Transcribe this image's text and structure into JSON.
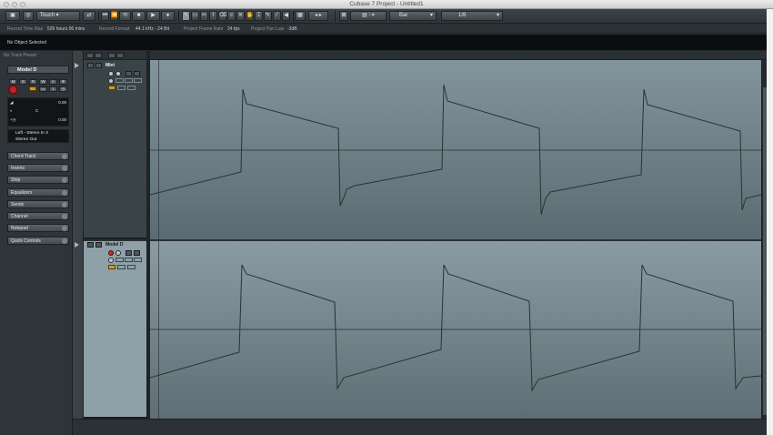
{
  "window": {
    "title": "Cubase 7 Project - Untitled1"
  },
  "toolbar": {
    "automation_mode": "Touch",
    "snap_type": "Bar",
    "quantize": "1/8"
  },
  "info_line": {
    "record_time_max_label": "Record Time Max",
    "record_time_max_value": "526 hours 06 mins",
    "record_format_label": "Record Format",
    "record_format_value": "44.1 kHz - 24 Bit",
    "frame_rate_label": "Project Frame Rate",
    "frame_rate_value": "24 fps",
    "pan_law_label": "Project Pan Law",
    "pan_law_value": "-3dB"
  },
  "event_line": {
    "text": "No Object Selected"
  },
  "inspector": {
    "preset": "No Track Preset",
    "track_name": "Model D",
    "volume": "0.00",
    "pan": "C",
    "delay": "0.00",
    "input_routing": "Left - Stereo In 3",
    "output_routing": "Stereo Out",
    "sections": [
      "Chord Track",
      "Inserts",
      "Strip",
      "Equalizers",
      "Sends",
      "Channel",
      "Notepad",
      "Quick Controls"
    ]
  },
  "tracks": [
    {
      "name": "Mini"
    },
    {
      "name": "Model D"
    }
  ],
  "colors": {
    "lane_top": "#82949c",
    "lane_bottom": "#5c6b72",
    "waveform": "#2a3236",
    "record": "#cc2a2a",
    "monitor": "#d39b2c"
  }
}
